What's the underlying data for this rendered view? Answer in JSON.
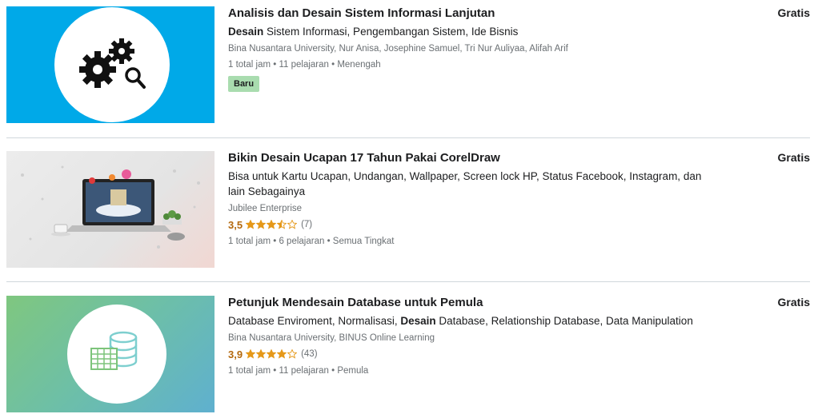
{
  "courses": [
    {
      "title": "Analisis dan Desain Sistem Informasi Lanjutan",
      "headline_bold": "Desain",
      "headline_rest": " Sistem Informasi, Pengembangan Sistem, Ide Bisnis",
      "instructors": "Bina Nusantara University, Nur Anisa, Josephine Samuel, Tri Nur Auliyaa, Alifah Arif",
      "meta": "1 total jam • 11 pelajaran • Menengah",
      "badge": "Baru",
      "price": "Gratis",
      "thumb_icon": "gears-search-icon",
      "thumb_color": "#00a9e8"
    },
    {
      "title": "Bikin Desain Ucapan 17 Tahun Pakai CorelDraw",
      "headline": "Bisa untuk Kartu Ucapan, Undangan, Wallpaper, Screen lock HP, Status Facebook, Instagram, dan lain Sebagainya",
      "instructors": "Jubilee Enterprise",
      "rating": "3,5",
      "rating_value": 3.5,
      "rating_count": "(7)",
      "meta": "1 total jam • 6 pelajaran • Semua Tingkat",
      "price": "Gratis",
      "thumb_icon": "laptop-mockup-icon"
    },
    {
      "title": "Petunjuk Mendesain Database untuk Pemula",
      "headline_pre": "Database Enviroment, Normalisasi, ",
      "headline_bold": "Desain",
      "headline_rest": " Database, Relationship Database, Data Manipulation",
      "instructors": "Bina Nusantara University, BINUS Online Learning",
      "rating": "3,9",
      "rating_value": 3.9,
      "rating_count": "(43)",
      "meta": "1 total jam • 11 pelajaran • Pemula",
      "price": "Gratis",
      "thumb_icon": "database-table-icon"
    }
  ],
  "colors": {
    "rating": "#b4690e",
    "star": "#e59819",
    "badge": "#a9dcaf",
    "thumb1": "#00a9e8",
    "thumb3_start": "#7fc77f",
    "thumb3_end": "#5fb0cf"
  }
}
